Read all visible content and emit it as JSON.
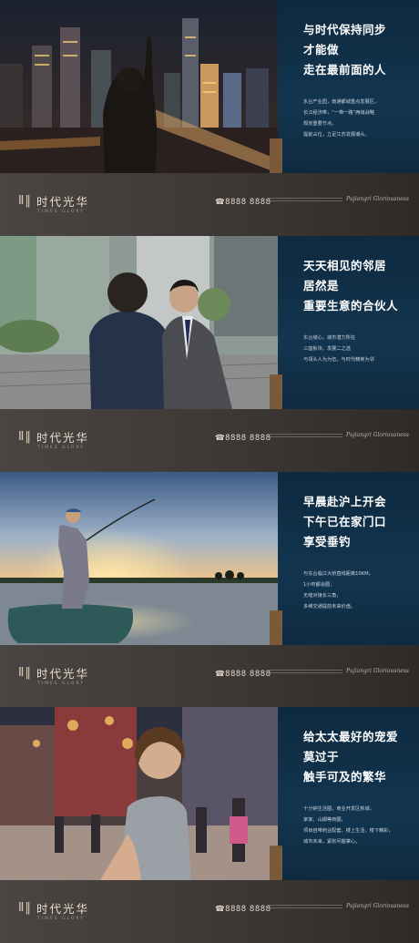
{
  "panels": [
    {
      "headline": [
        "与时代保持同步",
        "才能做",
        "走在最前面的人"
      ],
      "body": [
        "东台产业园，南通都城重点发展区，",
        "长江经济带，“一带一路”两级战略",
        "规划重要节点，",
        "提前占位，立足江苏发展潮头。"
      ]
    },
    {
      "headline": [
        "天天相见的邻居",
        "居然是",
        "重要生意的合伙人"
      ],
      "body": [
        "东台城心，城市潜力所在",
        "三座板块，发展二之选",
        "与领头人为为伍，与时代精英为邻"
      ]
    },
    {
      "headline": [
        "早晨赴沪上开会",
        "下午已在家门口",
        "享受垂钓"
      ],
      "body": [
        "与东台临江大桥直线距离10KM，",
        "1小时都会圈，",
        "无缝对接长三角，",
        "多维交通提前未来价值。"
      ]
    },
    {
      "headline": [
        "给太太最好的宠爱",
        "莫过于",
        "触手可及的繁华"
      ],
      "body": [
        "十分钟生活圈，商业开发区新城，",
        "家家、山姆等商圈，",
        "项目自带商业配套，楼上生活，楼下精彩，",
        "城市未来，紧张尽握掌心。"
      ]
    }
  ],
  "footer": {
    "logo_mark": "Ⅱ‖",
    "brand_cn": "时代光华",
    "brand_en": "TIMES GLORY",
    "phone": "☎8888 8888",
    "signature": "Pujiangri Gloriousness"
  }
}
